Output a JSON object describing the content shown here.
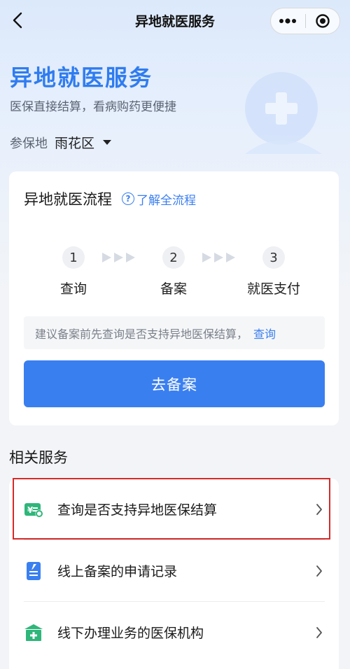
{
  "nav": {
    "title": "异地就医服务"
  },
  "hero": {
    "title": "异地就医服务",
    "subtitle": "医保直接结算，看病购药更便捷",
    "region_label": "参保地",
    "region_value": "雨花区"
  },
  "process": {
    "title": "异地就医流程",
    "full_flow_link": "了解全流程",
    "steps": [
      {
        "num": "1",
        "label": "查询"
      },
      {
        "num": "2",
        "label": "备案"
      },
      {
        "num": "3",
        "label": "就医支付"
      }
    ],
    "tip_text": "建议备案前先查询是否支持异地医保结算，",
    "tip_link": "查询",
    "button_label": "去备案"
  },
  "related": {
    "title": "相关服务",
    "items": [
      {
        "label": "查询是否支持异地医保结算",
        "icon": "settlement-check-icon"
      },
      {
        "label": "线上备案的申请记录",
        "icon": "document-edit-icon"
      },
      {
        "label": "线下办理业务的医保机构",
        "icon": "hospital-icon"
      }
    ]
  },
  "colors": {
    "accent": "#3a7ff0",
    "highlight": "#d42a2a",
    "icon_green": "#2fb67a",
    "icon_blue": "#3a7ff0"
  }
}
